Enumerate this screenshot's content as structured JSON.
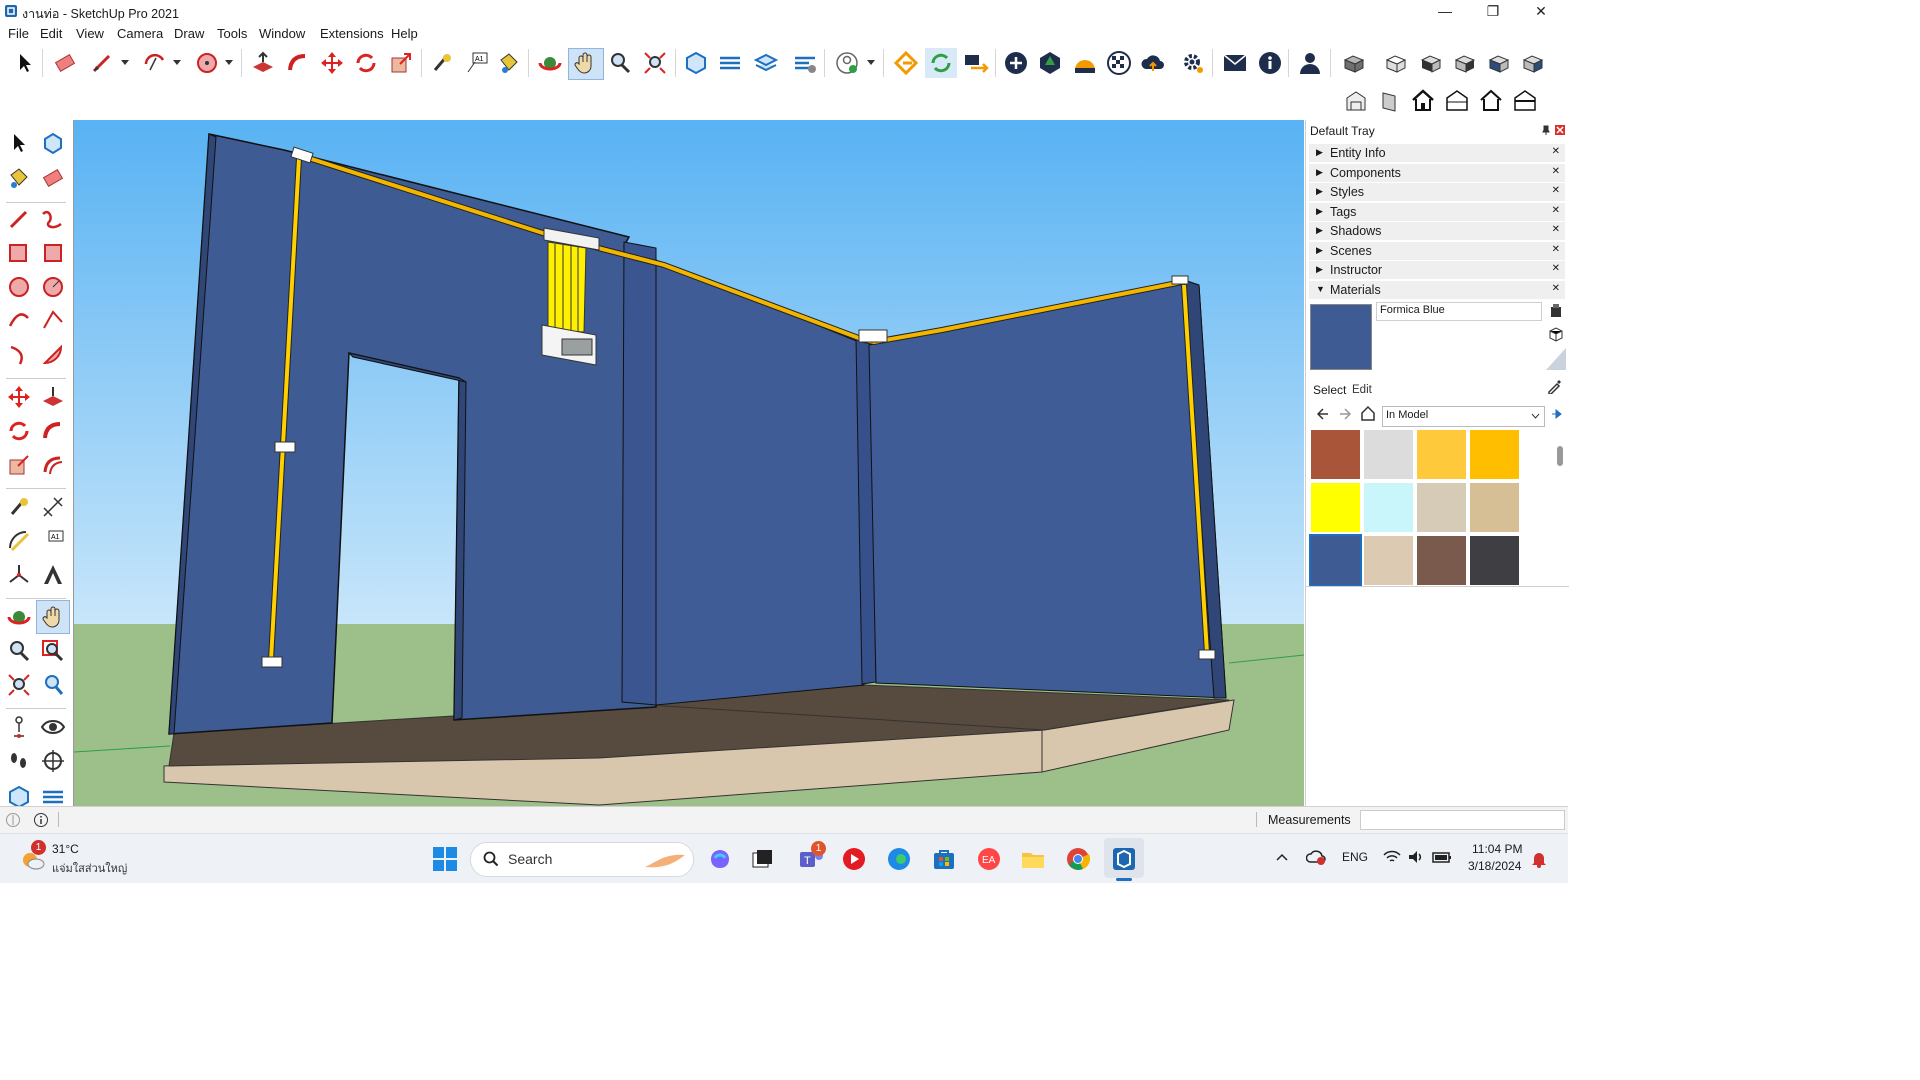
{
  "window": {
    "title": "งานท่อ - SketchUp Pro 2021",
    "minimize": "—",
    "maximize": "❐",
    "close": "✕"
  },
  "menu": [
    "File",
    "Edit",
    "View",
    "Camera",
    "Draw",
    "Tools",
    "Window",
    "Extensions",
    "Help"
  ],
  "tray": {
    "title": "Default Tray",
    "panels": [
      {
        "label": "Entity Info",
        "expanded": false
      },
      {
        "label": "Components",
        "expanded": false
      },
      {
        "label": "Styles",
        "expanded": false
      },
      {
        "label": "Tags",
        "expanded": false
      },
      {
        "label": "Shadows",
        "expanded": false
      },
      {
        "label": "Scenes",
        "expanded": false
      },
      {
        "label": "Instructor",
        "expanded": false
      },
      {
        "label": "Materials",
        "expanded": true
      }
    ],
    "materials": {
      "current_name": "Formica Blue",
      "current_color": "#3e5b94",
      "tab_select": "Select",
      "tab_edit": "Edit",
      "collection": "In Model",
      "swatches": [
        {
          "name": "brick",
          "color": "#a8553a"
        },
        {
          "name": "marble",
          "color": "#dcdcdc"
        },
        {
          "name": "orange-yellow",
          "color": "#ffc93c"
        },
        {
          "name": "amber",
          "color": "#ffbf00"
        },
        {
          "name": "yellow",
          "color": "#ffff00"
        },
        {
          "name": "light-cyan",
          "color": "#c8f6fa"
        },
        {
          "name": "stone-tile",
          "color": "#d6cbb6"
        },
        {
          "name": "tan",
          "color": "#d6bf94"
        },
        {
          "name": "formica-blue",
          "color": "#3e5b94"
        },
        {
          "name": "light-wood",
          "color": "#dccab3"
        },
        {
          "name": "brown-granite",
          "color": "#7a5a4c"
        },
        {
          "name": "dark-granite",
          "color": "#3f3f43"
        }
      ]
    }
  },
  "status": {
    "measurements_label": "Measurements"
  },
  "taskbar": {
    "weather_temp": "31°C",
    "weather_desc": "แจ่มใสส่วนใหญ่",
    "weather_badge": "1",
    "search_placeholder": "Search",
    "teams_badge": "1",
    "language": "ENG",
    "time": "11:04 PM",
    "date": "3/18/2024"
  },
  "colors": {
    "sky_top": "#5fb5f2",
    "sky_bottom": "#bfe2fa",
    "ground": "#9bbd87",
    "wall": "#3e5b94",
    "floor": "#5a4b3f",
    "base": "#d8c7ae",
    "pipe": "#f2b600"
  }
}
